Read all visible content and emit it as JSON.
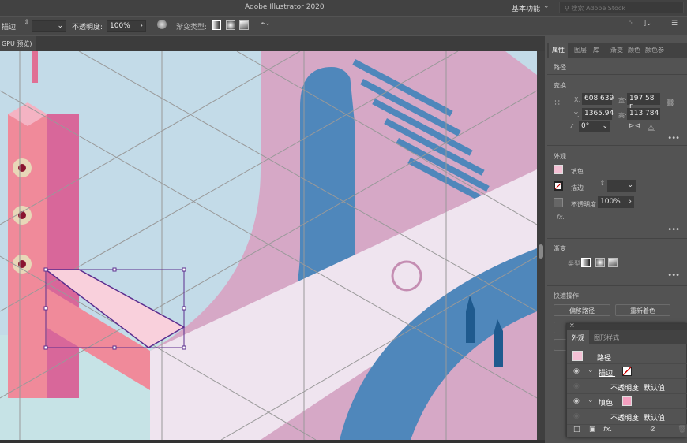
{
  "app": {
    "title": "Adobe Illustrator 2020",
    "workspace": "基本功能",
    "stock_placeholder": "搜索 Adobe Stock"
  },
  "control_bar": {
    "stroke_label": "描边:",
    "opacity_label": "不透明度:",
    "opacity_value": "100%",
    "gradient_type_label": "渐变类型:"
  },
  "document_tab": {
    "label": "GPU 预览)"
  },
  "panel": {
    "tabs": [
      "属性",
      "图层",
      "库",
      "渐变",
      "颜色",
      "颜色参"
    ],
    "object_type": "路径",
    "transform": {
      "title": "变换",
      "x_label": "X:",
      "x": "608.639",
      "y_label": "Y:",
      "y": "1365.94",
      "w_label": "宽:",
      "w": "197.58 r",
      "h_label": "高:",
      "h": "113.784",
      "angle": "0°"
    },
    "appearance": {
      "title": "外观",
      "fill_label": "填色",
      "stroke_label": "描边",
      "opacity_label": "不透明度",
      "opacity_value": "100%",
      "fx": "fx."
    },
    "gradient": {
      "title": "渐变",
      "type_label": "类型:"
    },
    "quick_actions": {
      "title": "快速操作",
      "offset_path": "偏移路径",
      "recolor": "重新着色"
    },
    "colors": {
      "fill": "#f4c0d4",
      "accent": "#ffffff"
    }
  },
  "appearance_panel": {
    "tabs": [
      "外观",
      "图形样式"
    ],
    "object": "路径",
    "stroke_label": "描边:",
    "stroke_opacity": "不透明度: 默认值",
    "fill_label": "填色:",
    "fill_opacity": "不透明度: 默认值",
    "fx": "fx."
  }
}
